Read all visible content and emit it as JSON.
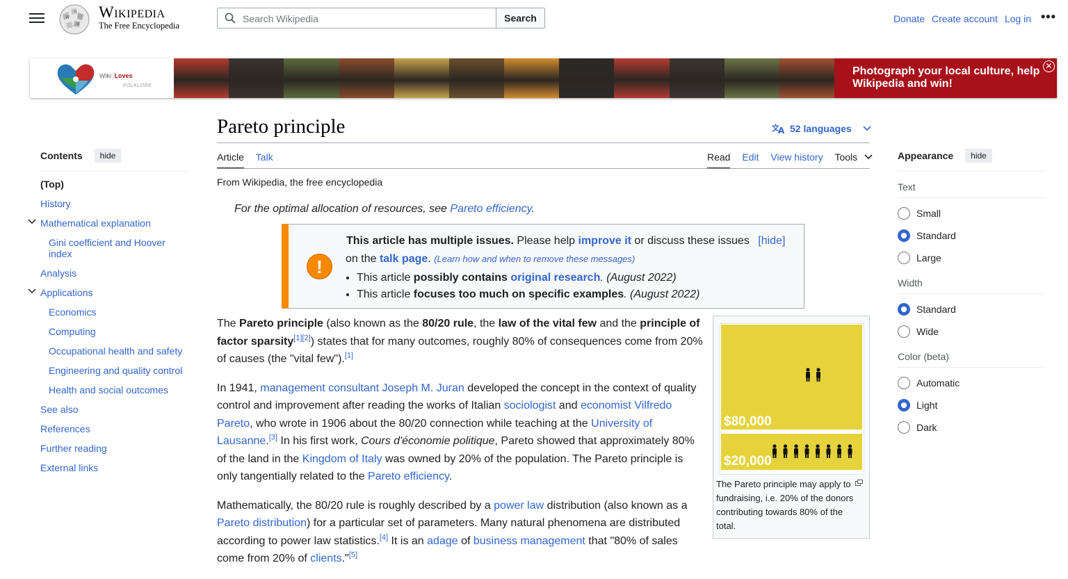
{
  "header": {
    "wordmark": "Wikipedia",
    "tagline": "The Free Encyclopedia",
    "search_placeholder": "Search Wikipedia",
    "search_button": "Search",
    "links": [
      "Donate",
      "Create account",
      "Log in"
    ],
    "more": "•••"
  },
  "banner": {
    "logo_text_1": "Wiki",
    "logo_text_2": "Loves",
    "logo_text_3": "FOLKLORE",
    "cta_line1": "Photograph your local culture, help",
    "cta_line2": "Wikipedia and win!",
    "close": "✕",
    "photo_colors": [
      "#b53a2d",
      "#3a3430",
      "#5d6b3b",
      "#8a4b2b",
      "#c4a24a",
      "#6b4f2c",
      "#d18a2e",
      "#2d2a28",
      "#b33b30",
      "#3b3633",
      "#6a7444",
      "#a25030"
    ]
  },
  "toc": {
    "title": "Contents",
    "hide": "hide",
    "items": [
      {
        "label": "(Top)",
        "level": 0
      },
      {
        "label": "History",
        "level": 0
      },
      {
        "label": "Mathematical explanation",
        "level": 0,
        "expandable": true
      },
      {
        "label": "Gini coefficient and Hoover index",
        "level": 1
      },
      {
        "label": "Analysis",
        "level": 0
      },
      {
        "label": "Applications",
        "level": 0,
        "expandable": true
      },
      {
        "label": "Economics",
        "level": 1
      },
      {
        "label": "Computing",
        "level": 1
      },
      {
        "label": "Occupational health and safety",
        "level": 1
      },
      {
        "label": "Engineering and quality control",
        "level": 1
      },
      {
        "label": "Health and social outcomes",
        "level": 1
      },
      {
        "label": "See also",
        "level": 0
      },
      {
        "label": "References",
        "level": 0
      },
      {
        "label": "Further reading",
        "level": 0
      },
      {
        "label": "External links",
        "level": 0
      }
    ]
  },
  "article": {
    "title": "Pareto principle",
    "languages": "52 languages",
    "tabs_left": [
      "Article",
      "Talk"
    ],
    "tabs_right": [
      "Read",
      "Edit",
      "View history",
      "Tools"
    ],
    "from": "From Wikipedia, the free encyclopedia",
    "hatnote_prefix": "For the optimal allocation of resources, see ",
    "hatnote_link": "Pareto efficiency",
    "hatnote_suffix": "."
  },
  "ambox": {
    "icon": "!",
    "bold": "This article has multiple issues.",
    "text1": " Please help ",
    "link1": "improve it",
    "text2": " or discuss these issues",
    "hide": "[hide]",
    "text3": "on the ",
    "link2": "talk page",
    "text4": ". ",
    "learn": "(Learn how and when to remove these messages)",
    "issue1_pre": "This article ",
    "issue1_bold": "possibly contains ",
    "issue1_link": "original research",
    "issue1_date": ". (August 2022)",
    "issue2_pre": "This article ",
    "issue2_bold": "focuses too much on specific examples",
    "issue2_date": ". (August 2022)"
  },
  "paragraphs": {
    "p1": {
      "a": "The ",
      "b": "Pareto principle",
      "c": " (also known as the ",
      "d": "80/20 rule",
      "e": ", the ",
      "f": "law of the vital few",
      "g": " and the ",
      "h": "principle of factor sparsity",
      "ref1": "[1]",
      "ref2": "[2]",
      "i": ") states that for many outcomes, roughly 80% of consequences come from 20% of causes (the \"vital few\").",
      "ref3": "[1]"
    },
    "p2": {
      "a": "In 1941, ",
      "l1": "management consultant",
      "sp": " ",
      "l2": "Joseph M. Juran",
      "b": " developed the concept in the context of quality control and improvement after reading the works of Italian ",
      "l3": "sociologist",
      "c": " and ",
      "l4": "economist",
      "sp2": " ",
      "l5": "Vilfredo Pareto",
      "d": ", who wrote in 1906 about the 80/20 connection while teaching at the ",
      "l6": "University of Lausanne",
      "e": ".",
      "ref": "[3]",
      "f": " In his first work, ",
      "g": "Cours d'économie politique",
      "h": ", Pareto showed that approximately 80% of the land in the ",
      "l7": "Kingdom of Italy",
      "i": " was owned by 20% of the population. The Pareto principle is only tangentially related to the ",
      "l8": "Pareto efficiency",
      "j": "."
    },
    "p3": {
      "a": "Mathematically, the 80/20 rule is roughly described by a ",
      "l1": "power law",
      "b": " distribution (also known as a ",
      "l2": "Pareto distribution",
      "c": ") for a particular set of parameters. Many natural phenomena are distributed according to power law statistics.",
      "ref1": "[4]",
      "d": " It is an ",
      "l3": "adage",
      "e": " of ",
      "l4": "business management",
      "f": " that \"80% of sales come from 20% of ",
      "l5": "clients",
      "g": ".\"",
      "ref2": "[5]"
    }
  },
  "thumb": {
    "top_amount": "$80,000",
    "bottom_amount": "$20,000",
    "caption": "The Pareto principle may apply to fundraising, i.e. 20% of the donors contributing towards 80% of the total.",
    "colors": {
      "fill": "#e6d33b",
      "figure": "#111111"
    }
  },
  "appearance": {
    "title": "Appearance",
    "hide": "hide",
    "sections": [
      {
        "label": "Text",
        "options": [
          "Small",
          "Standard",
          "Large"
        ],
        "selected": "Standard"
      },
      {
        "label": "Width",
        "options": [
          "Standard",
          "Wide"
        ],
        "selected": "Standard"
      },
      {
        "label": "Color (beta)",
        "options": [
          "Automatic",
          "Light",
          "Dark"
        ],
        "selected": "Light"
      }
    ]
  }
}
